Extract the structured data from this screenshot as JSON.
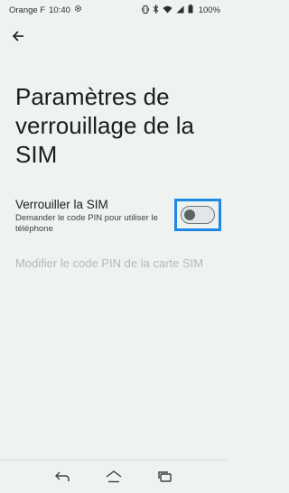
{
  "status_bar": {
    "carrier": "Orange F",
    "time": "10:40",
    "battery": "100%",
    "icons": [
      "settings-gear-icon",
      "vibrate-icon",
      "bluetooth-icon",
      "wifi-icon",
      "signal-icon",
      "battery-icon"
    ]
  },
  "header": {
    "back_icon": "arrow-left-icon",
    "title": "Paramètres de verrouillage de la SIM"
  },
  "lock_sim": {
    "title": "Verrouiller la SIM",
    "subtitle": "Demander le code PIN pour utiliser le téléphone",
    "toggle_state": "off"
  },
  "change_pin": {
    "label": "Modifier le code PIN de la carte SIM",
    "enabled": false
  },
  "colors": {
    "background": "#eef2f1",
    "highlight": "#1e88e5",
    "disabled_text": "#b5b9ba"
  },
  "nav_bar": {
    "buttons": [
      "back-nav-icon",
      "home-nav-icon",
      "recents-nav-icon"
    ]
  }
}
